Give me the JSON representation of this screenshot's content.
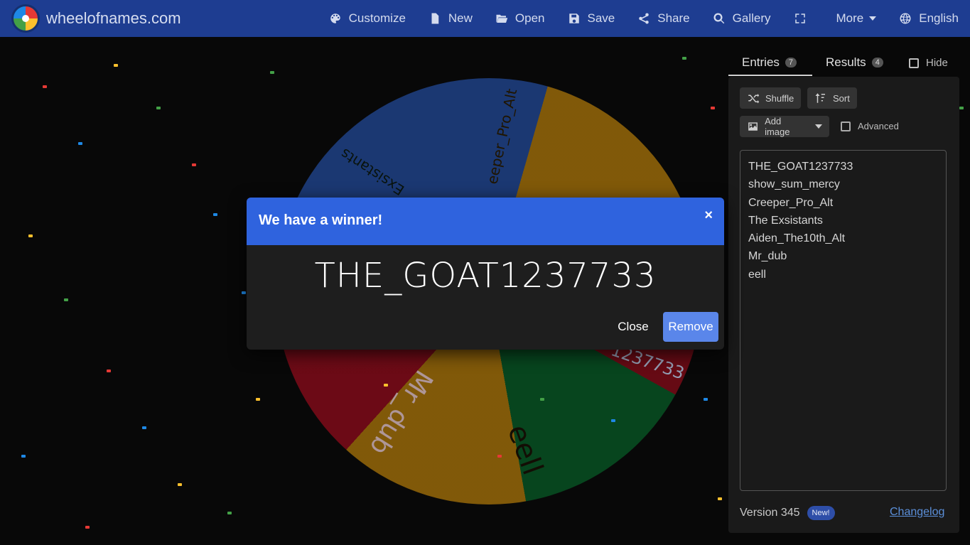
{
  "header": {
    "site_name": "wheelofnames.com",
    "nav": [
      {
        "label": "Customize",
        "icon": "palette-icon"
      },
      {
        "label": "New",
        "icon": "file-icon"
      },
      {
        "label": "Open",
        "icon": "folder-open-icon"
      },
      {
        "label": "Save",
        "icon": "floppy-disk-icon"
      },
      {
        "label": "Share",
        "icon": "share-icon"
      },
      {
        "label": "Gallery",
        "icon": "search-icon"
      },
      {
        "label": "",
        "icon": "fullscreen-icon"
      },
      {
        "label": "More",
        "icon": "chevron-down-icon"
      },
      {
        "label": "English",
        "icon": "globe-icon"
      }
    ]
  },
  "wheel": {
    "slices": [
      {
        "label": "THE_GOAT1237733",
        "color": "#2956b2"
      },
      {
        "label": "eell",
        "color": "#c88a0c"
      },
      {
        "label": "Mr_dub",
        "color": "#a70f21"
      },
      {
        "label": "Aiden_The10th_Alt",
        "color": "#2956b2"
      },
      {
        "label": "The Exsistants",
        "color": "#0a6b2e"
      },
      {
        "label": "Creeper_Pro_Alt",
        "color": "#c88a0c"
      },
      {
        "label": "show_sum_mercy",
        "color": "#9e0f1e"
      }
    ],
    "visible_fragments": {
      "top_green": "Exsistants",
      "top_yellow": "eeper_Pro_Alt",
      "bottom_red": "Mr_dub",
      "bottom_yellow": "eell",
      "bottom_blue": "1237733"
    }
  },
  "sidebar": {
    "tabs": [
      {
        "label": "Entries",
        "count": "7",
        "active": true
      },
      {
        "label": "Results",
        "count": "4",
        "active": false
      }
    ],
    "hide_label": "Hide",
    "shuffle_label": "Shuffle",
    "sort_label": "Sort",
    "add_image_label": "Add image",
    "advanced_label": "Advanced",
    "entries": [
      "THE_GOAT1237733",
      "show_sum_mercy",
      "Creeper_Pro_Alt",
      "The Exsistants",
      "Aiden_The10th_Alt",
      "Mr_dub",
      "eell"
    ],
    "version_label": "Version 345",
    "new_badge": "New!",
    "changelog_label": "Changelog"
  },
  "modal": {
    "title": "We have a winner!",
    "close_glyph": "×",
    "winner": "THE_GOAT1237733",
    "close_button": "Close",
    "remove_button": "Remove"
  },
  "colors": {
    "topbar": "#1e3d91",
    "modal_header": "#2f63de",
    "remove_button": "#5a86ea"
  }
}
